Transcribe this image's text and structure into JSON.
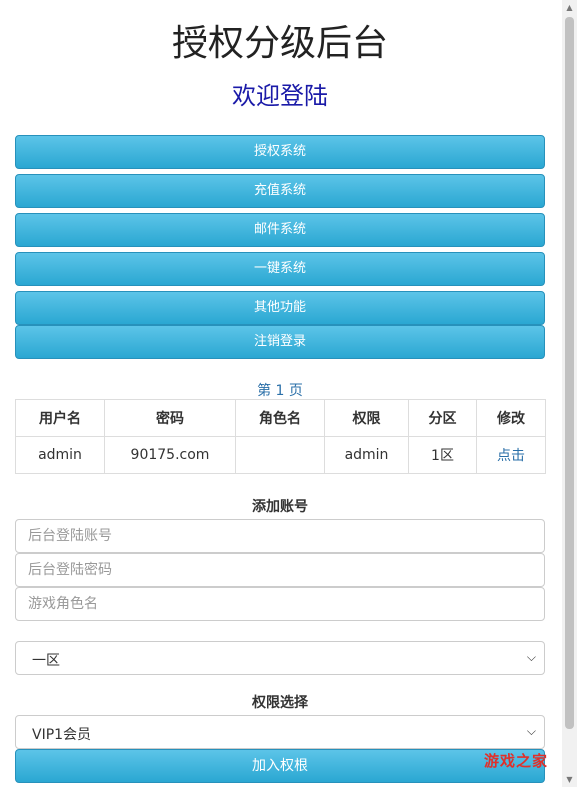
{
  "header": {
    "title": "授权分级后台",
    "subtitle": "欢迎登陆"
  },
  "nav": {
    "items": [
      {
        "label": "授权系统"
      },
      {
        "label": "充值系统"
      },
      {
        "label": "邮件系统"
      },
      {
        "label": "一键系统"
      },
      {
        "label": "其他功能"
      },
      {
        "label": "注销登录"
      }
    ]
  },
  "pagination": {
    "label": "第 1 页"
  },
  "table": {
    "columns": [
      "用户名",
      "密码",
      "角色名",
      "权限",
      "分区",
      "修改"
    ],
    "rows": [
      [
        "admin",
        "90175.com",
        "",
        "admin",
        "1区",
        "点击"
      ]
    ]
  },
  "add_account": {
    "heading": "添加账号",
    "account_placeholder": "后台登陆账号",
    "password_placeholder": "后台登陆密码",
    "role_placeholder": "游戏角色名",
    "zone_selected": "一区"
  },
  "permission": {
    "heading": "权限选择",
    "selected": "VIP1会员",
    "submit_label": "加入权根"
  },
  "icons": {
    "select_caret": "chevron-down-icon",
    "scroll_up": "arrow-up-icon",
    "scroll_down": "arrow-down-icon"
  },
  "watermark": {
    "text": "游戏之家"
  },
  "colors": {
    "button_accent": "#2aa7d2",
    "subtitle": "#1a1aa8",
    "link": "#2a6fa8"
  }
}
